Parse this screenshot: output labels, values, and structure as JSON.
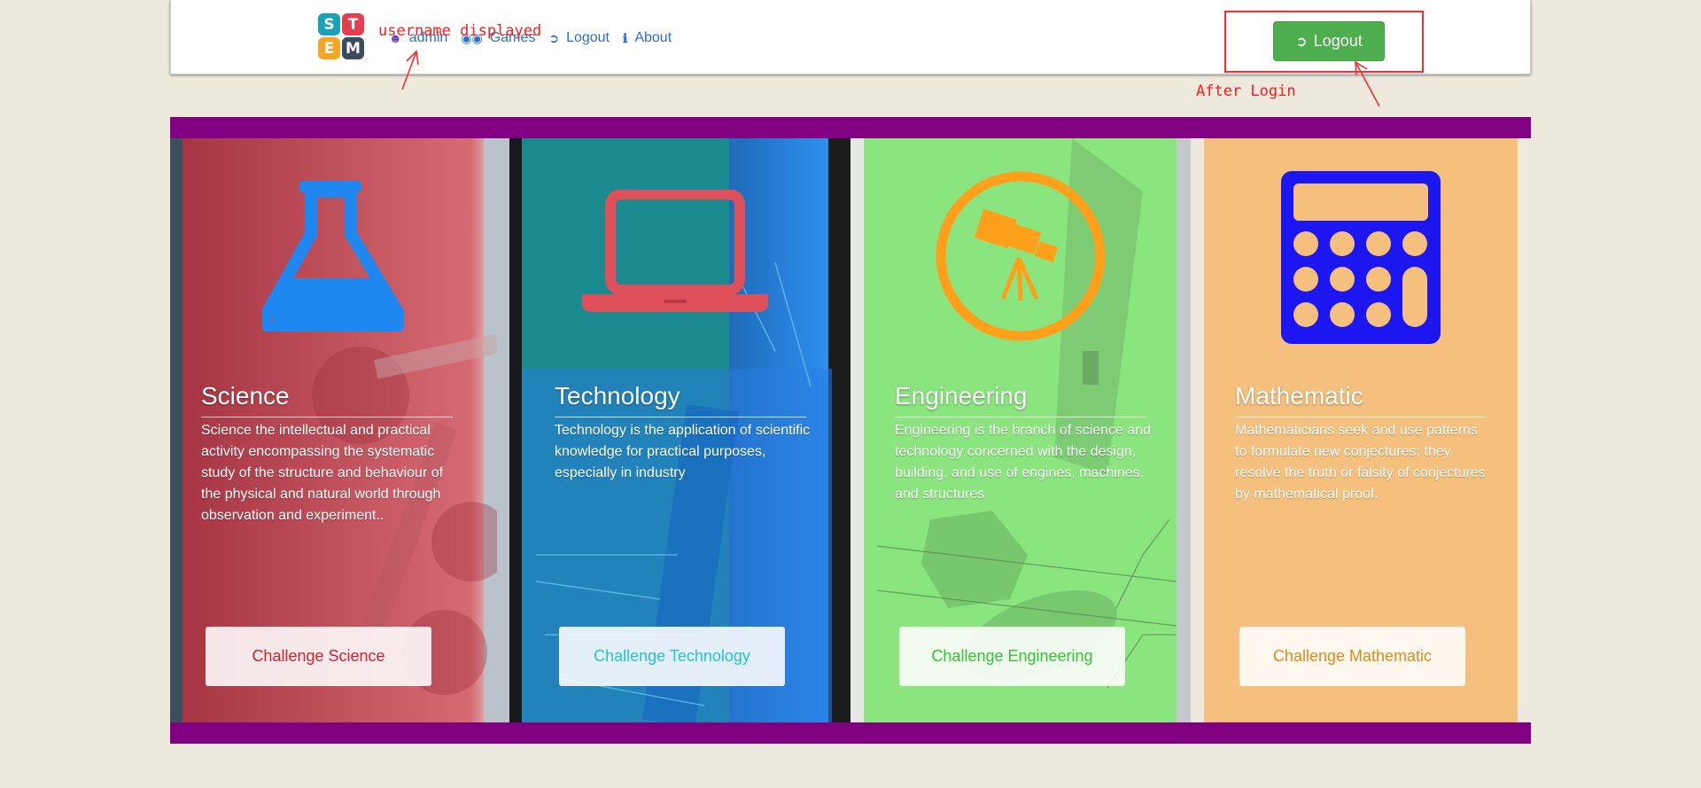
{
  "logo": {
    "letters": [
      "S",
      "T",
      "E",
      "M"
    ],
    "colors": [
      "#1aa3b8",
      "#e63d50",
      "#f5a623",
      "#3b4a5c"
    ]
  },
  "nav": {
    "items": [
      {
        "icon": "user-icon",
        "label": "admin"
      },
      {
        "icon": "gamepad-icon",
        "label": "Games"
      },
      {
        "icon": "sign-out-icon",
        "label": "Logout"
      },
      {
        "icon": "info-icon",
        "label": "About"
      }
    ]
  },
  "header_button": {
    "icon": "sign-out-icon",
    "label": "Logout"
  },
  "annotations": {
    "username": "username displayed",
    "after_login": "After Login"
  },
  "panels": [
    {
      "title": "Science",
      "description": "Science the intellectual and practical activity encompassing the systematic study of the structure and behaviour of the physical and natural world through observation and experiment..",
      "button": "Challenge Science",
      "icon": "flask-icon",
      "color": "#cc3a46",
      "icon_color": "#1e88f0",
      "button_text_color": "#c9262f"
    },
    {
      "title": "Technology",
      "description": "Technology is the application of scientific knowledge for practical purposes, especially in industry",
      "button": "Challenge Technology",
      "icon": "laptop-icon",
      "color": "#1a8a8e",
      "icon_color": "#e0505b",
      "button_text_color": "#27c1d6"
    },
    {
      "title": "Engineering",
      "description": "Engineering is the branch of science and technology concerned with the design, building, and use of engines, machines, and structures",
      "button": "Challenge Engineering",
      "icon": "telescope-icon",
      "color": "#8ae57e",
      "icon_color": "#ff9f1a",
      "button_text_color": "#36c236"
    },
    {
      "title": "Mathematic",
      "description": "Mathematicians seek and use patterns to formulate new conjectures; they resolve the truth or falsity of conjectures by mathematical proof.",
      "button": "Challenge Mathematic",
      "icon": "calculator-icon",
      "color": "#f5c07e",
      "icon_color": "#1c16f0",
      "button_text_color": "#e08b1c"
    }
  ],
  "colors": {
    "band": "#820082",
    "background": "#ede9dc",
    "logout_green": "#4cae4c"
  }
}
